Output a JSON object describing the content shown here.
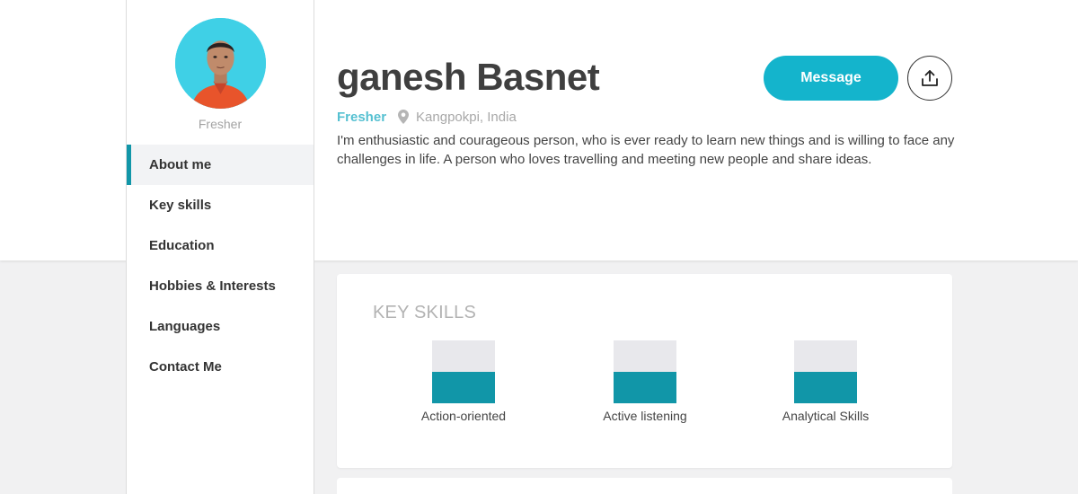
{
  "profile": {
    "role_caption": "Fresher",
    "name": "ganesh Basnet",
    "status": "Fresher",
    "location": "Kangpokpi, India",
    "bio": "I'm enthusiastic and courageous person, who is ever ready to learn new things and is willing to face any challenges in life. A person who loves travelling and meeting new people and share ideas."
  },
  "nav": {
    "items": [
      {
        "label": "About me",
        "active": true
      },
      {
        "label": "Key skills",
        "active": false
      },
      {
        "label": "Education",
        "active": false
      },
      {
        "label": "Hobbies & Interests",
        "active": false
      },
      {
        "label": "Languages",
        "active": false
      },
      {
        "label": "Contact Me",
        "active": false
      }
    ]
  },
  "actions": {
    "message_label": "Message",
    "share_icon": "share-upload-icon"
  },
  "key_skills": {
    "title": "KEY SKILLS",
    "items": [
      {
        "label": "Action-oriented",
        "level": 0.5
      },
      {
        "label": "Active listening",
        "level": 0.5
      },
      {
        "label": "Analytical Skills",
        "level": 0.5
      }
    ]
  },
  "colors": {
    "accent": "#14b4cc",
    "bar_fill": "#1196a8",
    "bar_track": "#e8e8ec",
    "status_text": "#55c0d1",
    "page_bg": "#f1f1f2"
  }
}
